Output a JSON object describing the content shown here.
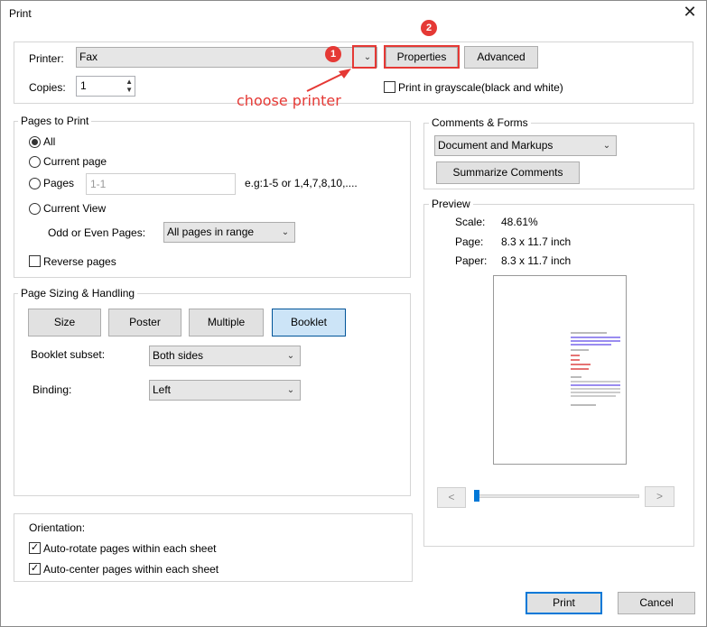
{
  "window": {
    "title": "Print",
    "close_glyph": "✕"
  },
  "printer": {
    "label": "Printer:",
    "value": "Fax",
    "properties_label": "Properties",
    "advanced_label": "Advanced",
    "copies_label": "Copies:",
    "copies_value": "1",
    "grayscale_label": "Print in grayscale(black and white)",
    "grayscale_checked": false
  },
  "annotations": {
    "step1": "1",
    "step2": "2",
    "choose_printer": "choose printer",
    "color": "#e53935"
  },
  "pages_to_print": {
    "title": "Pages to Print",
    "all_label": "All",
    "current_page_label": "Current page",
    "pages_label": "Pages",
    "pages_value": "1-1",
    "pages_hint": "e.g:1-5 or 1,4,7,8,10,....",
    "current_view_label": "Current View",
    "odd_even_label": "Odd or Even Pages:",
    "odd_even_value": "All pages in range",
    "reverse_label": "Reverse pages",
    "selected": "All"
  },
  "page_sizing": {
    "title": "Page Sizing & Handling",
    "buttons": [
      "Size",
      "Poster",
      "Multiple",
      "Booklet"
    ],
    "selected": "Booklet",
    "subset_label": "Booklet subset:",
    "subset_value": "Both sides",
    "binding_label": "Binding:",
    "binding_value": "Left"
  },
  "orientation": {
    "title": "Orientation:",
    "auto_rotate_label": "Auto-rotate pages within each sheet",
    "auto_center_label": "Auto-center pages within each sheet"
  },
  "comments_forms": {
    "title": "Comments & Forms",
    "value": "Document and Markups",
    "summarize_label": "Summarize Comments"
  },
  "preview": {
    "title": "Preview",
    "scale_label": "Scale:",
    "scale_value": "48.61%",
    "page_label": "Page:",
    "page_value": "8.3 x 11.7 inch",
    "paper_label": "Paper:",
    "paper_value": "8.3 x 11.7 inch",
    "prev_glyph": "<",
    "next_glyph": ">"
  },
  "footer": {
    "print_label": "Print",
    "cancel_label": "Cancel"
  }
}
